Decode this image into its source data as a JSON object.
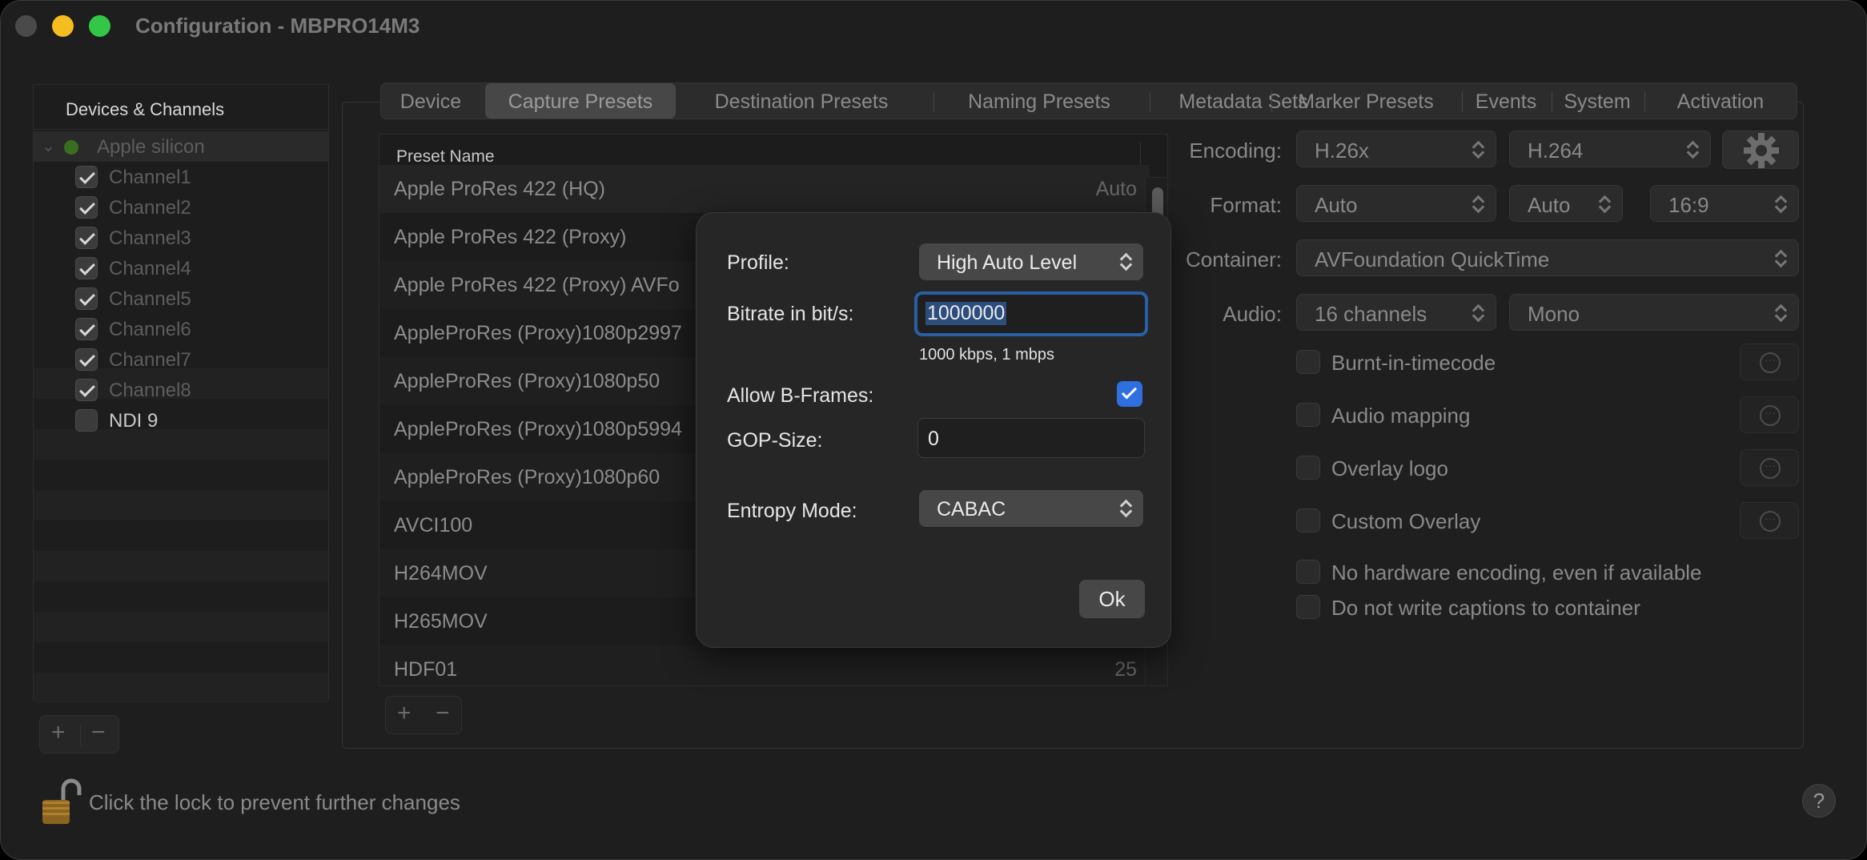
{
  "window": {
    "title": "Configuration - MBPRO14M3"
  },
  "sidebar": {
    "header": "Devices & Channels",
    "group": {
      "label": "Apple silicon",
      "status_color": "#3a6e1f"
    },
    "items": [
      {
        "label": "Channel1",
        "checked": true
      },
      {
        "label": "Channel2",
        "checked": true
      },
      {
        "label": "Channel3",
        "checked": true
      },
      {
        "label": "Channel4",
        "checked": true
      },
      {
        "label": "Channel5",
        "checked": true
      },
      {
        "label": "Channel6",
        "checked": true
      },
      {
        "label": "Channel7",
        "checked": true
      },
      {
        "label": "Channel8",
        "checked": true
      },
      {
        "label": "NDI 9",
        "checked": false
      }
    ],
    "add_label": "+",
    "remove_label": "−"
  },
  "tabs": [
    "Device",
    "Capture Presets",
    "Destination Presets",
    "Naming Presets",
    "Metadata Sets",
    "Marker Presets",
    "Events",
    "System",
    "Activation"
  ],
  "active_tab": "Capture Presets",
  "presets": {
    "column_header": "Preset Name",
    "rows": [
      {
        "name": "Apple ProRes 422 (HQ)",
        "value": "Auto"
      },
      {
        "name": "Apple ProRes 422 (Proxy)",
        "value": ""
      },
      {
        "name": "Apple ProRes 422 (Proxy) AVFo",
        "value": ""
      },
      {
        "name": "AppleProRes (Proxy)1080p2997",
        "value": ""
      },
      {
        "name": "AppleProRes (Proxy)1080p50",
        "value": ""
      },
      {
        "name": "AppleProRes (Proxy)1080p5994",
        "value": ""
      },
      {
        "name": "AppleProRes (Proxy)1080p60",
        "value": ""
      },
      {
        "name": "AVCI100",
        "value": ""
      },
      {
        "name": "H264MOV",
        "value": ""
      },
      {
        "name": "H265MOV",
        "value": ""
      },
      {
        "name": "HDF01",
        "value": "25"
      }
    ],
    "add_label": "+",
    "remove_label": "−"
  },
  "settings": {
    "encoding_label": "Encoding:",
    "encoding_value": "H.26x",
    "codec_value": "H.264",
    "format_label": "Format:",
    "format_value": "Auto",
    "format_rate": "Auto",
    "format_aspect": "16:9",
    "container_label": "Container:",
    "container_value": "AVFoundation QuickTime",
    "audio_label": "Audio:",
    "audio_channels": "16 channels",
    "audio_mode": "Mono",
    "options": [
      {
        "label": "Burnt-in-timecode",
        "checked": false
      },
      {
        "label": "Audio mapping",
        "checked": false
      },
      {
        "label": "Overlay logo",
        "checked": false
      },
      {
        "label": "Custom Overlay",
        "checked": false
      },
      {
        "label": "No hardware encoding, even if available",
        "checked": false
      },
      {
        "label": "Do not write captions to container",
        "checked": false
      }
    ]
  },
  "dialog": {
    "profile_label": "Profile:",
    "profile_value": "High Auto Level",
    "bitrate_label": "Bitrate in bit/s:",
    "bitrate_value": "1000000",
    "bitrate_hint": "1000 kbps, 1 mbps",
    "bframes_label": "Allow B-Frames:",
    "bframes_checked": true,
    "gop_label": "GOP-Size:",
    "gop_value": "0",
    "entropy_label": "Entropy Mode:",
    "entropy_value": "CABAC",
    "ok_label": "Ok"
  },
  "footer": {
    "lock_text": "Click the lock to prevent further changes",
    "help_label": "?"
  },
  "colors": {
    "accent": "#2f6fdf",
    "close": "#4a4a4a",
    "minimize": "#f5bd20",
    "zoom": "#33c748"
  }
}
